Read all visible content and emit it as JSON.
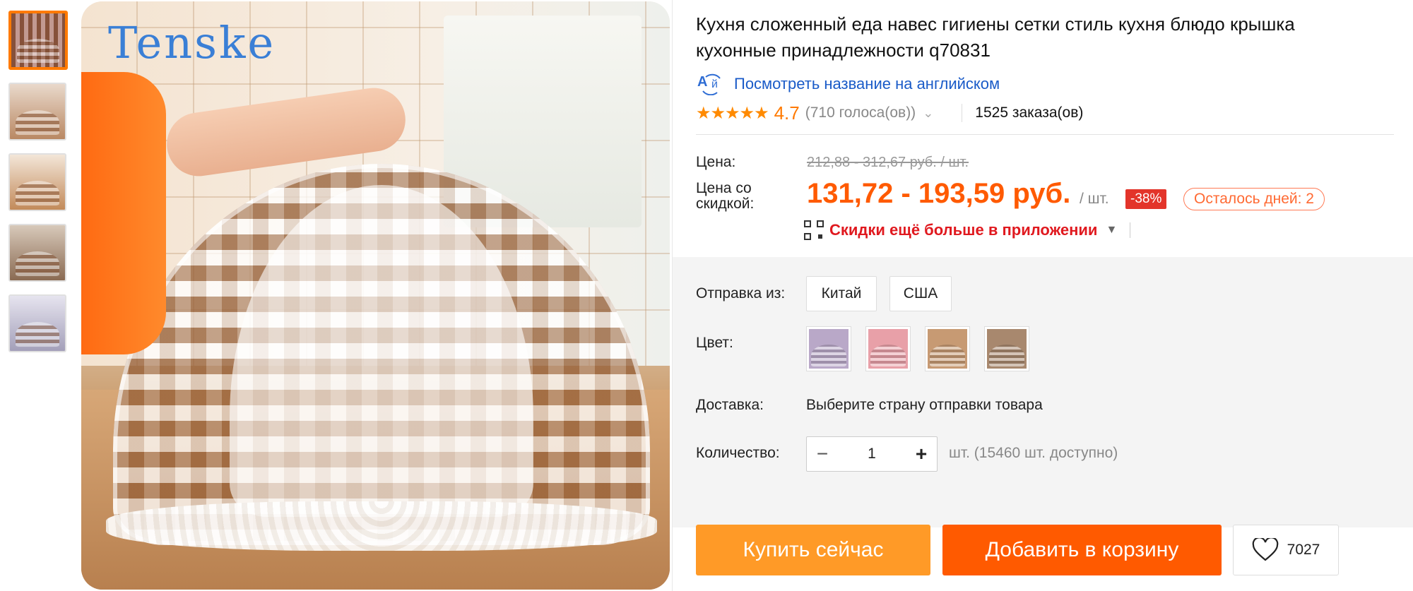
{
  "brand_logo_text": "Tenske",
  "product": {
    "title": "Кухня сложенный еда навес гигиены сетки стиль кухня блюдо крышка кухонные принадлежности q70831",
    "translate_link": "Посмотреть название на английском",
    "translate_icon_text": "A",
    "translate_icon_text2": "й",
    "rating_stars": "★★★★★",
    "rating_value": "4.7",
    "votes": "(710 голоса(ов))",
    "orders": "1525 заказа(ов)"
  },
  "price": {
    "label": "Цена:",
    "old": "212,88 - 312,67 руб. / шт.",
    "discount_label": "Цена со скидкой:",
    "discount_value": "131,72 - 193,59 руб.",
    "per_unit": "/ шт.",
    "discount_badge": "-38%",
    "days_left": "Осталось дней: 2",
    "app_promo": "Скидки ещё больше в приложении"
  },
  "options": {
    "ship_from_label": "Отправка из:",
    "ship_from": [
      "Китай",
      "США"
    ],
    "color_label": "Цвет:",
    "color_swatches": [
      "#b9a8c8",
      "#e8a0a8",
      "#c79a73",
      "#a8886e"
    ],
    "delivery_label": "Доставка:",
    "delivery_value": "Выберите страну отправки товара",
    "quantity_label": "Количество:",
    "quantity_value": "1",
    "quantity_minus": "−",
    "quantity_plus": "+",
    "available": "шт. (15460 шт. доступно)"
  },
  "actions": {
    "buy_now": "Купить сейчас",
    "add_to_cart": "Добавить в корзину",
    "wishlist_count": "7027"
  },
  "colors": {
    "accent_orange": "#ff5a00",
    "buy_now": "#ff9a27",
    "link_blue": "#1a5bc8",
    "badge_red": "#e3342a"
  }
}
